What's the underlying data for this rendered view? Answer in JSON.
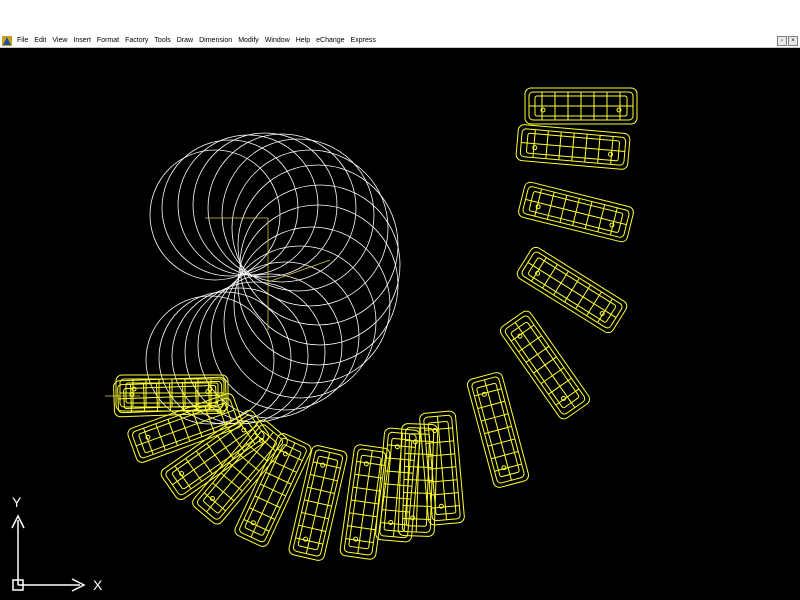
{
  "menu": {
    "items": [
      "File",
      "Edit",
      "View",
      "Insert",
      "Format",
      "Factory",
      "Tools",
      "Draw",
      "Dimension",
      "Modify",
      "Window",
      "Help",
      "eChange",
      "Express"
    ]
  },
  "window_controls": {
    "restore": "▫",
    "close": "×"
  },
  "ucs": {
    "y_label": "Y",
    "x_label": "X"
  },
  "colors": {
    "canvas": "#000000",
    "wireframe": "#ffff33",
    "construction": "#ffffff",
    "axis_line": "#d4c84a"
  }
}
